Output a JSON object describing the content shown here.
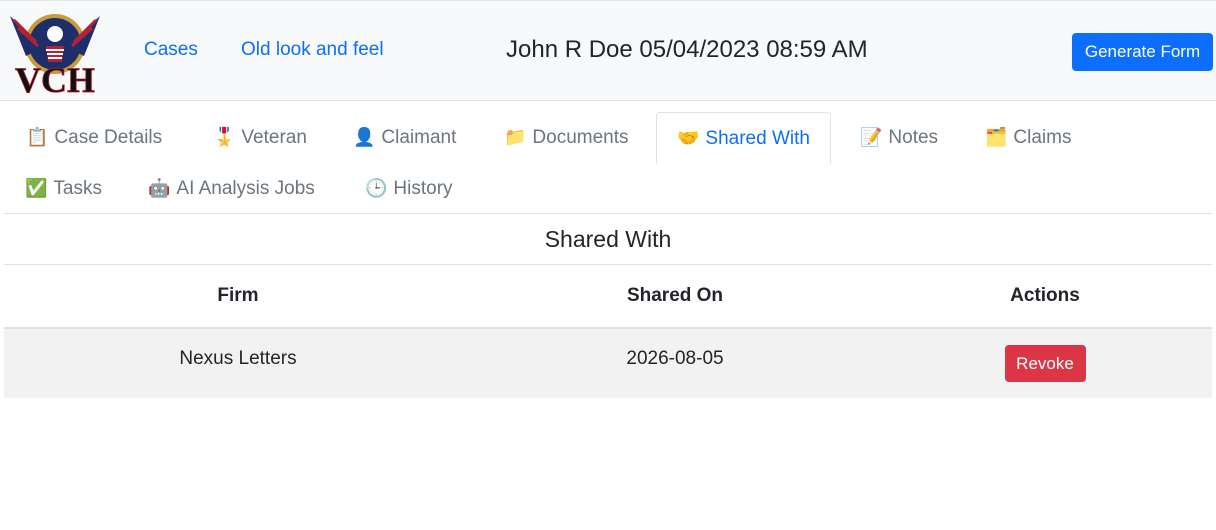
{
  "header": {
    "logo_text": "VCH",
    "nav": {
      "cases": "Cases",
      "old_look": "Old look and feel"
    },
    "title": "John R Doe 05/04/2023 08:59 AM",
    "generate_button": "Generate Form"
  },
  "tabs": [
    {
      "icon": "📋",
      "label": "Case Details"
    },
    {
      "icon": "🎖️",
      "label": "Veteran"
    },
    {
      "icon": "👤",
      "label": "Claimant"
    },
    {
      "icon": "📁",
      "label": "Documents"
    },
    {
      "icon": "🤝",
      "label": "Shared With",
      "active": true
    },
    {
      "icon": "📝",
      "label": "Notes"
    },
    {
      "icon": "🗂️",
      "label": "Claims"
    },
    {
      "icon": "✅",
      "label": "Tasks"
    },
    {
      "icon": "🤖",
      "label": "AI Analysis Jobs"
    },
    {
      "icon": "🕒",
      "label": "History"
    }
  ],
  "panel": {
    "title": "Shared With",
    "columns": [
      "Firm",
      "Shared On",
      "Actions"
    ],
    "rows": [
      {
        "firm": "Nexus Letters",
        "shared_on": "2026-08-05",
        "action": "Revoke"
      }
    ]
  },
  "colors": {
    "accent": "#0d6efd",
    "danger": "#dc3545",
    "header_bg": "#f8f9fa"
  }
}
